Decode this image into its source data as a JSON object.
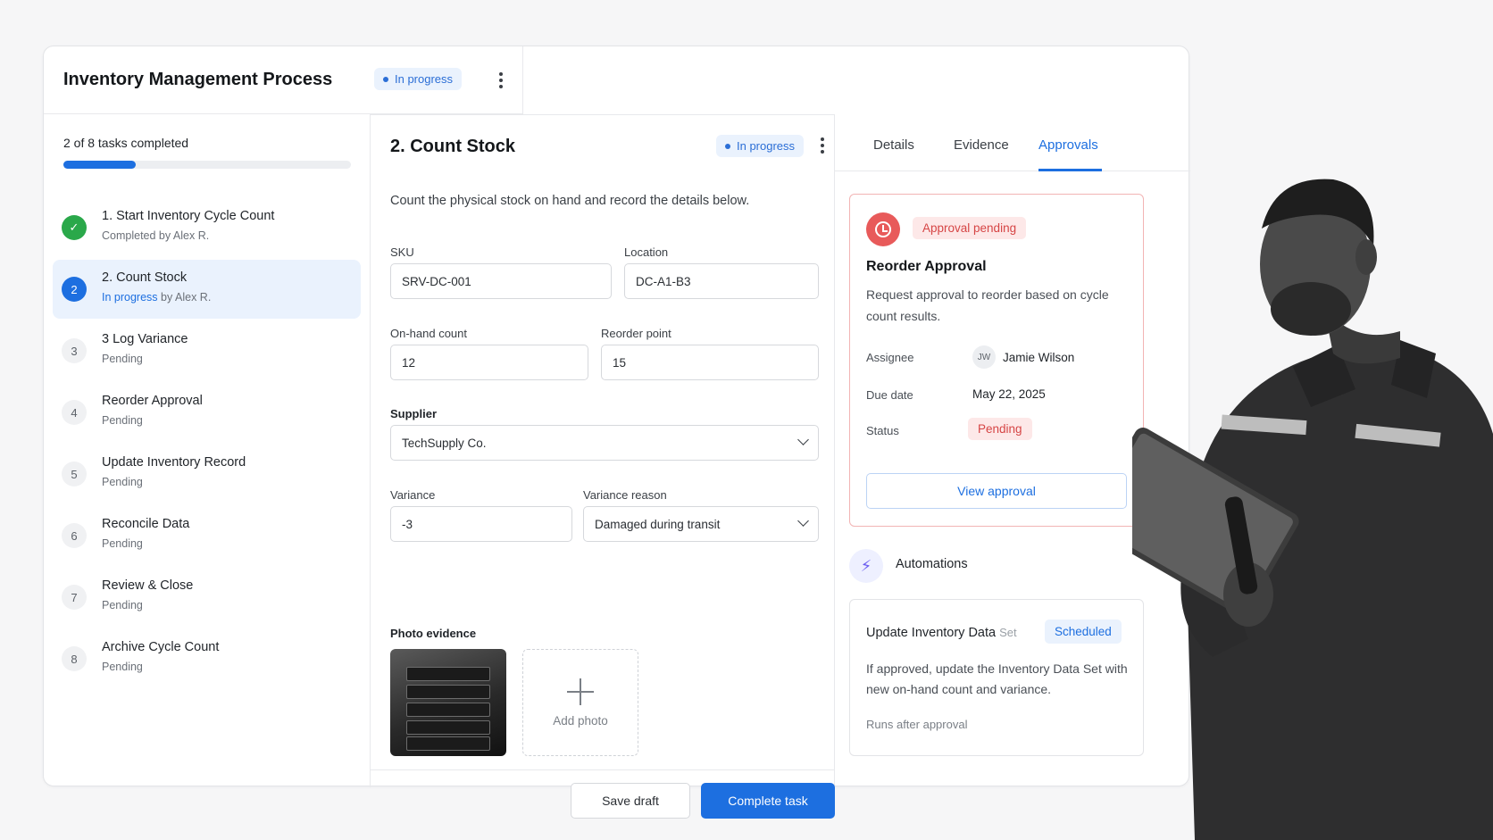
{
  "process": {
    "title": "Inventory Management Process",
    "status": "In progress"
  },
  "progress": {
    "label": "2 of 8 tasks completed",
    "fraction": 0.25
  },
  "tasks": [
    {
      "number": "",
      "title": "1. Start Inventory Cycle Count",
      "sub": "Completed by Alex R.",
      "state": "done"
    },
    {
      "number": "2",
      "title": "2. Count Stock",
      "sub_status": "In progress",
      "sub_by": "by Alex R.",
      "state": "current"
    },
    {
      "number": "3",
      "title": "3 Log Variance",
      "sub": "Pending",
      "state": "pending"
    },
    {
      "number": "4",
      "title": "Reorder Approval",
      "sub": "Pending",
      "state": "pending"
    },
    {
      "number": "5",
      "title": "Update Inventory Record",
      "sub": "Pending",
      "state": "pending"
    },
    {
      "number": "6",
      "title": "Reconcile Data",
      "sub": "Pending",
      "state": "pending"
    },
    {
      "number": "7",
      "title": "Review & Close",
      "sub": "Pending",
      "state": "pending"
    },
    {
      "number": "8",
      "title": "Archive Cycle Count",
      "sub": "Pending",
      "state": "pending"
    }
  ],
  "task_detail": {
    "title": "2. Count Stock",
    "status": "In progress",
    "description": "Count the physical stock on hand and record the details below.",
    "fields": {
      "sku": {
        "label": "SKU",
        "value": "SRV-DC-001"
      },
      "location": {
        "label": "Location",
        "value": "DC-A1-B3"
      },
      "on_hand": {
        "label": "On-hand count",
        "value": "12"
      },
      "reorder_point": {
        "label": "Reorder point",
        "value": "15"
      },
      "supplier": {
        "label": "Supplier",
        "value": "TechSupply Co."
      },
      "variance": {
        "label": "Variance",
        "value": "-3"
      },
      "variance_reason": {
        "label": "Variance reason",
        "value": "Damaged during transit"
      }
    },
    "photo_label": "Photo evidence",
    "add_photo": "Add photo",
    "save_draft": "Save draft",
    "complete_task": "Complete task"
  },
  "tabs": [
    "Details",
    "Evidence",
    "Approvals"
  ],
  "active_tab": "Approvals",
  "approval": {
    "badge": "Approval pending",
    "title": "Reorder Approval",
    "description": "Request approval to reorder based on cycle count results.",
    "assignee_label": "Assignee",
    "assignee_initials": "JW",
    "assignee_name": "Jamie Wilson",
    "due_label": "Due date",
    "due_value": "May 22, 2025",
    "status_label": "Status",
    "status_value": "Pending",
    "view_button": "View approval"
  },
  "automations": {
    "title": "Automations",
    "item_title": "Update Inventory Data",
    "item_title_suffix": "Set",
    "item_badge": "Scheduled",
    "item_description": "If approved, update the Inventory Data Set with new on-hand count and variance.",
    "item_footer": "Runs after approval"
  },
  "colors": {
    "accent": "#1d6fe0",
    "success": "#2aa84a",
    "danger": "#e85a5a",
    "pill_bg": "#eaf2fd"
  }
}
